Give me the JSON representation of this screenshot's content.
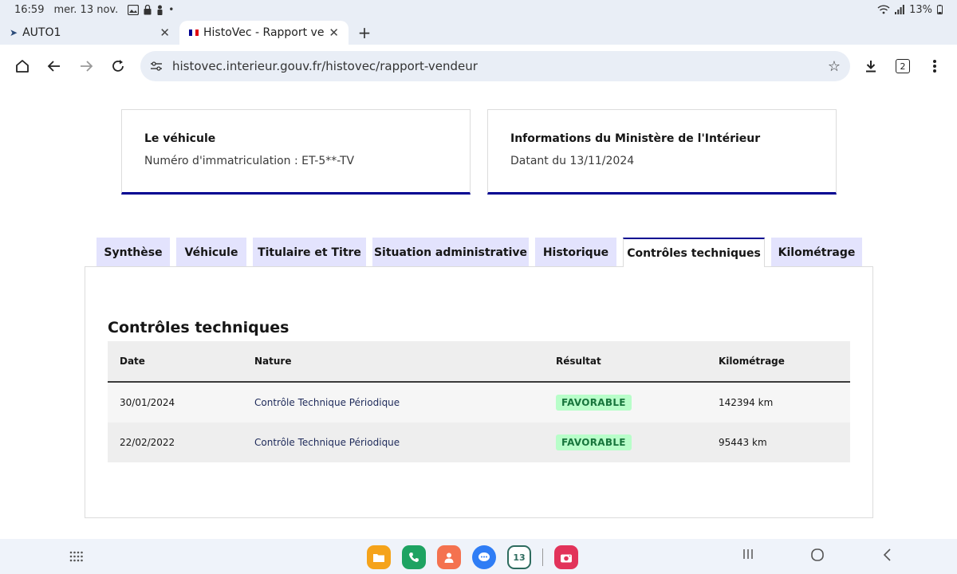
{
  "status_bar": {
    "time": "16:59",
    "date": "mer. 13 nov.",
    "battery": "13%"
  },
  "browser": {
    "tabs": [
      {
        "label": "AUTO1"
      },
      {
        "label": "HistoVec - Rapport vende"
      }
    ],
    "url": "histovec.interieur.gouv.fr/histovec/rapport-vendeur",
    "tab_count": "2"
  },
  "vehicle_card": {
    "title": "Le véhicule",
    "text": "Numéro d'immatriculation : ET-5**-TV"
  },
  "ministry_card": {
    "title": "Informations du Ministère de l'Intérieur",
    "text": "Datant du 13/11/2024"
  },
  "report_tabs": [
    {
      "label": "Synthèse"
    },
    {
      "label": "Véhicule"
    },
    {
      "label": "Titulaire et Titre"
    },
    {
      "label": "Situation administrative"
    },
    {
      "label": "Historique"
    },
    {
      "label": "Contrôles techniques"
    },
    {
      "label": "Kilométrage"
    }
  ],
  "active_tab": "Contrôles techniques",
  "section": {
    "title": "Contrôles techniques",
    "columns": [
      "Date",
      "Nature",
      "Résultat",
      "Kilométrage"
    ],
    "rows": [
      {
        "date": "30/01/2024",
        "nature": "Contrôle Technique Périodique",
        "result": "FAVORABLE",
        "km": "142394 km"
      },
      {
        "date": "22/02/2022",
        "nature": "Contrôle Technique Périodique",
        "result": "FAVORABLE",
        "km": "95443 km"
      }
    ]
  },
  "dock": {
    "calendar_day": "13"
  },
  "colors": {
    "accent": "#000091",
    "tab_bg": "#e3e3fd",
    "badge_bg": "#b8fec9",
    "badge_text": "#18753c"
  }
}
